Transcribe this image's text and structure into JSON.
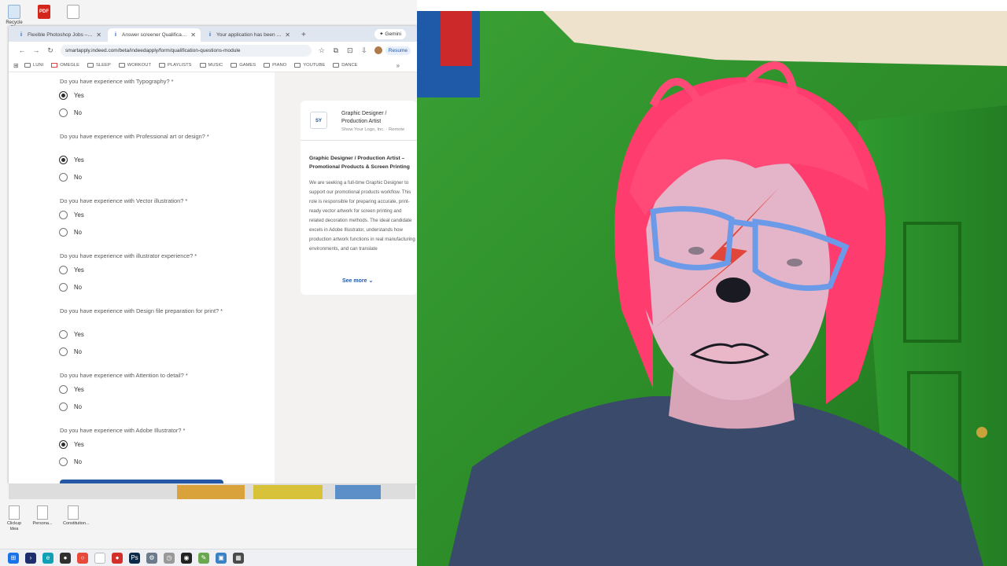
{
  "desktop": {
    "icons": [
      {
        "label": "Recycle Bin",
        "type": "recycle"
      },
      {
        "label": "PDF",
        "type": "pdf"
      },
      {
        "label": "",
        "type": "doc"
      }
    ],
    "bottom_icons": [
      {
        "label": "Clickup Idea"
      },
      {
        "label": "Persona..."
      },
      {
        "label": "Constitution..."
      }
    ]
  },
  "browser": {
    "tabs": [
      {
        "label": "Flexible Photoshop Jobs – Apply",
        "active": false
      },
      {
        "label": "Answer screener Qualification",
        "active": true
      },
      {
        "label": "Your application has been sub",
        "active": false
      }
    ],
    "new_tab": "+",
    "gemini_label": "Gemini",
    "url": "smartapply.indeed.com/beta/indeedapply/form/qualification-questions-module",
    "resume_label": "Resume",
    "bookmarks": [
      {
        "label": "LUNI",
        "type": "folder"
      },
      {
        "label": "OMEGLE",
        "type": "mail"
      },
      {
        "label": "SLEEP",
        "type": "folder"
      },
      {
        "label": "WORKOUT",
        "type": "folder"
      },
      {
        "label": "PLAYLISTS",
        "type": "folder"
      },
      {
        "label": "MUSIC",
        "type": "folder"
      },
      {
        "label": "GAMES",
        "type": "folder"
      },
      {
        "label": "PIANO",
        "type": "folder"
      },
      {
        "label": "YOUTUBE",
        "type": "folder"
      },
      {
        "label": "DANCE",
        "type": "folder"
      }
    ]
  },
  "form": {
    "questions": [
      {
        "text": "Do you have experience with Typography? *",
        "selected": "Yes",
        "options": [
          "Yes",
          "No"
        ]
      },
      {
        "text": "Do you have experience with Professional art or design? *",
        "selected": "Yes",
        "options": [
          "Yes",
          "No"
        ]
      },
      {
        "text": "Do you have experience with Vector illustration? *",
        "selected": null,
        "options": [
          "Yes",
          "No"
        ]
      },
      {
        "text": "Do you have experience with illustrator experience? *",
        "selected": null,
        "options": [
          "Yes",
          "No"
        ]
      },
      {
        "text": "Do you have experience with Design file preparation for print? *",
        "selected": null,
        "options": [
          "Yes",
          "No"
        ]
      },
      {
        "text": "Do you have experience with Attention to detail? *",
        "selected": null,
        "options": [
          "Yes",
          "No"
        ]
      },
      {
        "text": "Do you have experience with Adobe Illustrator? *",
        "selected": "Yes",
        "options": [
          "Yes",
          "No"
        ]
      }
    ]
  },
  "job_card": {
    "logo_text": "SY",
    "title": "Graphic Designer / Production Artist",
    "company": "Show Your Logo, Inc. · Remote",
    "description_title": "Graphic Designer / Production Artist – Promotional Products & Screen Printing",
    "description": "We are seeking a full-time Graphic Designer to support our promotional products workflow. This role is responsible for preparing accurate, print-ready vector artwork for screen printing and related decoration methods. The ideal candidate excels in Adobe Illustrator, understands how production artwork functions in real manufacturing environments, and can translate",
    "see_more": "See more"
  },
  "colors": {
    "indeed_blue": "#2557a7",
    "panel_bg": "#f3f2f1",
    "webcam_green": "#2c8c2a",
    "hair_pink": "#ff3c6e"
  }
}
